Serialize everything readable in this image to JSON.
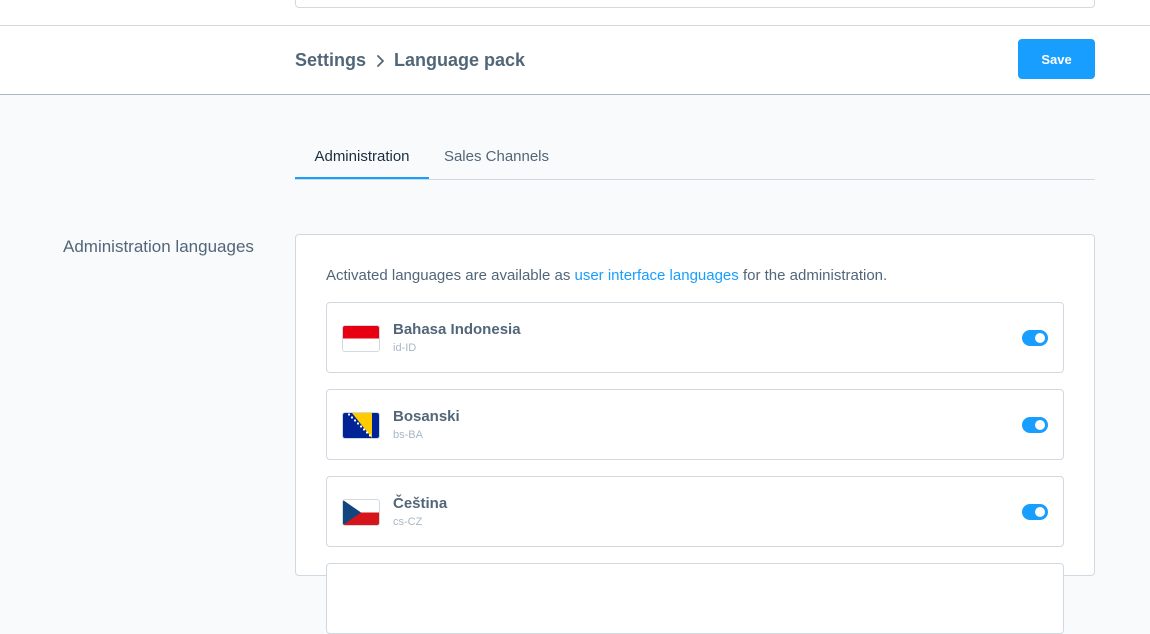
{
  "breadcrumb": {
    "parent": "Settings",
    "current": "Language pack"
  },
  "header": {
    "save_label": "Save"
  },
  "tabs": [
    {
      "label": "Administration",
      "active": true
    },
    {
      "label": "Sales Channels",
      "active": false
    }
  ],
  "section": {
    "label": "Administration languages",
    "description_prefix": "Activated languages are available as ",
    "description_link": "user interface languages",
    "description_suffix": " for the administration."
  },
  "languages": [
    {
      "name": "Bahasa Indonesia",
      "code": "id-ID",
      "flag": "flag-id-icon",
      "enabled": true
    },
    {
      "name": "Bosanski",
      "code": "bs-BA",
      "flag": "flag-ba-icon",
      "enabled": true
    },
    {
      "name": "Čeština",
      "code": "cs-CZ",
      "flag": "flag-cz-icon",
      "enabled": true
    }
  ],
  "colors": {
    "accent": "#189eff",
    "text": "#52667a",
    "border": "#d1d9e0",
    "background": "#f9fafb"
  }
}
